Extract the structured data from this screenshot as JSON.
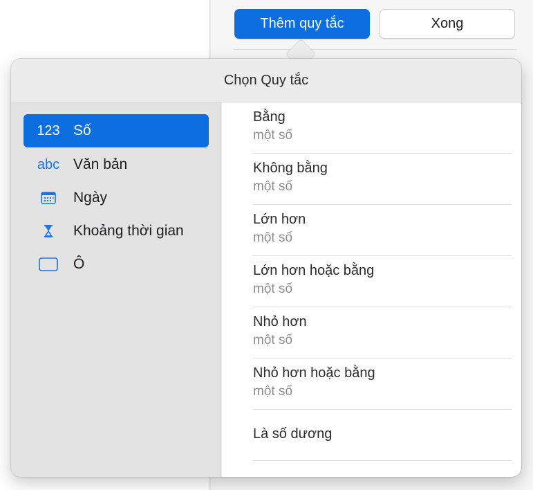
{
  "toolbar": {
    "add_rule_label": "Thêm quy tắc",
    "done_label": "Xong"
  },
  "popover": {
    "title": "Chọn Quy tắc"
  },
  "sidebar": {
    "items": [
      {
        "icon_text": "123",
        "label": "Số",
        "selected": true
      },
      {
        "icon_text": "abc",
        "label": "Văn bản"
      },
      {
        "icon": "calendar-icon",
        "label": "Ngày"
      },
      {
        "icon": "hourglass-icon",
        "label": "Khoảng thời gian"
      },
      {
        "icon": "cell-rectangle-icon",
        "label": "Ô"
      }
    ]
  },
  "rules": [
    {
      "title": "Bằng",
      "subtitle": "một số"
    },
    {
      "title": "Không bằng",
      "subtitle": "một số"
    },
    {
      "title": "Lớn hơn",
      "subtitle": "một số"
    },
    {
      "title": "Lớn hơn hoặc bằng",
      "subtitle": "một số"
    },
    {
      "title": "Nhỏ hơn",
      "subtitle": "một số"
    },
    {
      "title": "Nhỏ hơn hoặc bằng",
      "subtitle": "một số"
    },
    {
      "title": "Là số dương"
    }
  ],
  "colors": {
    "accent": "#0d6ee0",
    "icon_blue": "#1a73e8",
    "secondary_text": "#8e8e8e"
  }
}
